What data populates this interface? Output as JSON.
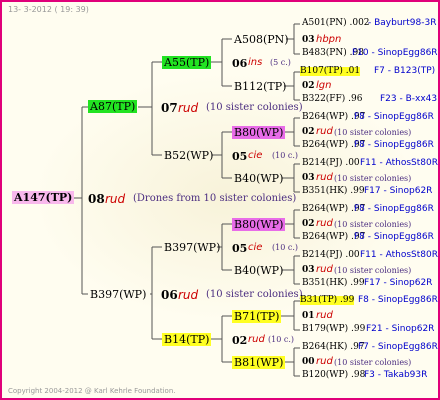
{
  "header": "13- 3-2012 ( 19: 39)",
  "footer": "Copyright 2004-2012 @ Karl Kehrle Foundation.",
  "root": "A147(TP)",
  "root_gen": "08",
  "root_queen": "rud",
  "root_note": "(Drones from 10 sister colonies)",
  "p1": "A87(TP)",
  "p1_gen": "07",
  "p1_queen": "rud",
  "p1_note": "(10 sister colonies)",
  "p1a": "A55(TP)",
  "p1a_gen": "06",
  "p1a_queen": "ins",
  "p1a_note": "(5 c.)",
  "p1a_s": "A508(PN)",
  "p1a_s_gen": "03",
  "p1a_s_queen": "hbpn",
  "p1a_s_top": "A501(PN) .002",
  "p1a_s_top_src": "- Bayburt98-3R",
  "p1a_s_bot": "B483(PN) .98",
  "p1a_s_bot_src": "F10 - SinopEgg86R",
  "p1a_d": "B112(TP)",
  "p1a_d_gen": "02",
  "p1a_d_queen": "lgn",
  "p1a_d_top": "B107(TP) .01",
  "p1a_d_top_src": "F7 - B123(TP)",
  "p1a_d_bot": "B322(FF) .96",
  "p1a_d_bot_src": "F23 - B-xx43",
  "p1b": "B52(WP)",
  "p1b_gen": "05",
  "p1b_queen": "cie",
  "p1b_note": "(10 c.)",
  "p1b_s": "B80(WP)",
  "p1b_s_gen": "02",
  "p1b_s_queen": "rud",
  "p1b_s_note": "(10 sister colonies)",
  "p1b_s_top": "B264(WP) .97",
  "p1b_s_top_src": "F8 - SinopEgg86R",
  "p1b_s_bot": "B264(WP) .97",
  "p1b_s_bot_src": "F8 - SinopEgg86R",
  "p1b_d": "B40(WP)",
  "p1b_d_gen": "03",
  "p1b_d_queen": "rud",
  "p1b_d_note": "(10 sister colonies)",
  "p1b_d_top": "B214(PJ) .00",
  "p1b_d_top_src": "F11 - AthosSt80R",
  "p1b_d_bot": "B351(HK) .99",
  "p1b_d_bot_src": "F17 - Sinop62R",
  "p2": "B397(WP)",
  "p2_gen": "06",
  "p2_queen": "rud",
  "p2_note": "(10 sister colonies)",
  "p2a": "B397(WP)",
  "p2a_gen": "05",
  "p2a_queen": "cie",
  "p2a_note": "(10 c.)",
  "p2a_s": "B80(WP)",
  "p2a_s_gen": "02",
  "p2a_s_queen": "rud",
  "p2a_s_note": "(10 sister colonies)",
  "p2a_s_top": "B264(WP) .97",
  "p2a_s_top_src": "F8 - SinopEgg86R",
  "p2a_s_bot": "B264(WP) .97",
  "p2a_s_bot_src": "F8 - SinopEgg86R",
  "p2a_d": "B40(WP)",
  "p2a_d_gen": "03",
  "p2a_d_queen": "rud",
  "p2a_d_note": "(10 sister colonies)",
  "p2a_d_top": "B214(PJ) .00",
  "p2a_d_top_src": "F11 - AthosSt80R",
  "p2a_d_bot": "B351(HK) .99",
  "p2a_d_bot_src": "F17 - Sinop62R",
  "p2b": "B14(TP)",
  "p2b_gen": "02",
  "p2b_queen": "rud",
  "p2b_note": "(10 c.)",
  "p2b_s": "B71(TP)",
  "p2b_s_gen": "01",
  "p2b_s_queen": "rud",
  "p2b_s_top": "B31(TP) .99",
  "p2b_s_top_src": "F8 - SinopEgg86R",
  "p2b_s_bot": "B179(WP) .99",
  "p2b_s_bot_src": "F21 - Sinop62R",
  "p2b_d": "B81(WP)",
  "p2b_d_gen": "00",
  "p2b_d_queen": "rud",
  "p2b_d_note": "(10 sister colonies)",
  "p2b_d_top": "B264(HK) .97",
  "p2b_d_top_src": "F7 - SinopEgg86R",
  "p2b_d_bot": "B120(WP) .98",
  "p2b_d_bot_src": "F3 - Takab93R"
}
